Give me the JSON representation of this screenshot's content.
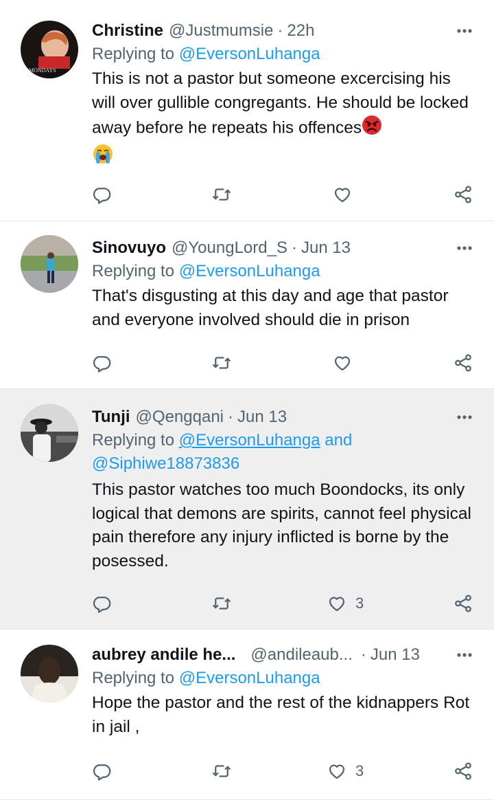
{
  "tweets": [
    {
      "name": "Christine",
      "handle": "@Justmumsie",
      "dot": "·",
      "time": "22h",
      "reply_prefix": "Replying to",
      "mentions": [
        "@EversonLuhanga"
      ],
      "text": "This is not a pastor but someone excercising his will over gullible congregants. He should be locked away before he repeats his offences",
      "emojis": [
        "angry-face",
        "loudly-crying-face"
      ],
      "likes": "",
      "avatar_caption": "MONDAYS"
    },
    {
      "name": "Sinovuyo",
      "handle": "@YoungLord_S",
      "dot": "·",
      "time": "Jun 13",
      "reply_prefix": "Replying to",
      "mentions": [
        "@EversonLuhanga"
      ],
      "text": "That's disgusting at this day and age that pastor and everyone involved should die in prison",
      "likes": ""
    },
    {
      "name": "Tunji",
      "handle": "@Qengqani",
      "dot": "·",
      "time": "Jun 13",
      "reply_prefix": "Replying to",
      "mentions": [
        "@EversonLuhanga",
        "@Siphiwe18873836"
      ],
      "mention_joiner": "and",
      "text": "This pastor watches too much Boondocks, its only logical that demons are spirits, cannot feel physical pain therefore any injury inflicted is borne by the posessed.",
      "likes": "3"
    },
    {
      "name": "aubrey andile he...",
      "handle": "@andileaub...",
      "dot": "·",
      "time": "Jun 13",
      "reply_prefix": "Replying to",
      "mentions": [
        "@EversonLuhanga"
      ],
      "text": "Hope the pastor and the rest of the kidnappers Rot in jail ,",
      "likes": "3"
    }
  ],
  "colors": {
    "accent": "#1d9bf0",
    "secondary_text": "#536471",
    "highlight_bg": "#efefef"
  },
  "icons": [
    "more-icon",
    "reply-icon",
    "retweet-icon",
    "like-icon",
    "share-icon"
  ]
}
